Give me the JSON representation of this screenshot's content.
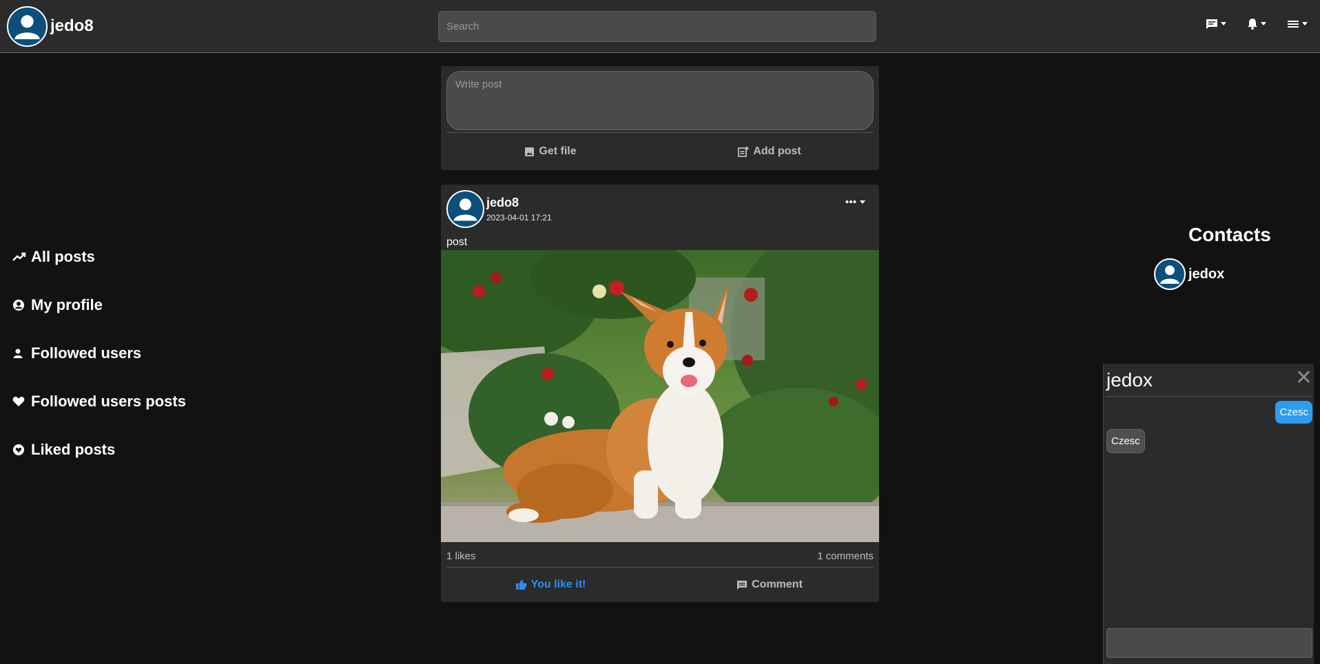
{
  "header": {
    "username": "jedo8",
    "search_placeholder": "Search",
    "icons": [
      "message-icon",
      "bell-icon",
      "menu-icon"
    ]
  },
  "sidebar": {
    "items": [
      {
        "label": "All posts",
        "icon": "trending-icon"
      },
      {
        "label": "My profile",
        "icon": "user-circle-icon"
      },
      {
        "label": "Followed users",
        "icon": "person-icon"
      },
      {
        "label": "Followed users posts",
        "icon": "heart-icon"
      },
      {
        "label": "Liked posts",
        "icon": "heart-circle-icon"
      }
    ]
  },
  "composer": {
    "placeholder": "Write post",
    "get_file_label": "Get file",
    "add_post_label": "Add post"
  },
  "post": {
    "author": "jedo8",
    "date": "2023-04-01 17:21",
    "text": "post",
    "image": "corgi-photo",
    "likes": "1 likes",
    "comments": "1 comments",
    "like_label": "You like it!",
    "comment_label": "Comment"
  },
  "contacts": {
    "title": "Contacts",
    "items": [
      {
        "name": "jedox"
      }
    ]
  },
  "chat": {
    "title": "jedox",
    "close": "✕",
    "messages": [
      {
        "text": "Czesc",
        "direction": "outgoing"
      },
      {
        "text": "Czesc",
        "direction": "incoming"
      }
    ]
  },
  "colors": {
    "background": "#121212",
    "panel": "#2b2b2b",
    "accent": "#2d8ff0",
    "avatar": "#0b4f7a"
  }
}
